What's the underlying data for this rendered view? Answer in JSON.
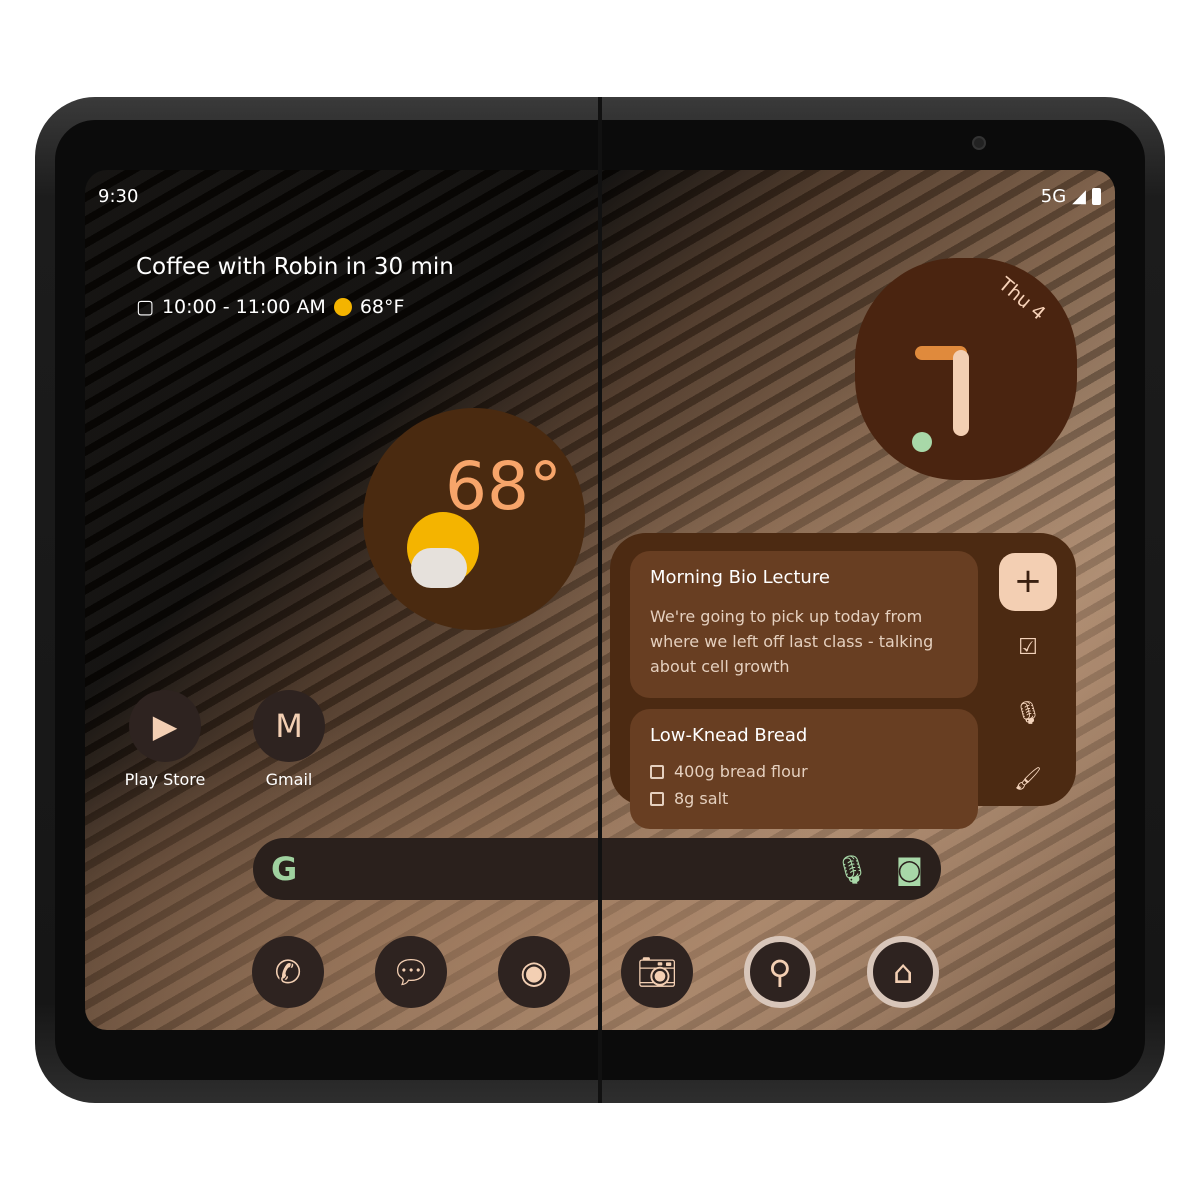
{
  "status": {
    "time": "9:30",
    "network": "5G"
  },
  "glance": {
    "title": "Coffee with Robin in 30 min",
    "time": "10:00 - 11:00 AM",
    "temp": "68°F"
  },
  "weather": {
    "temp": "68°"
  },
  "clock": {
    "date": "Thu 4"
  },
  "notes": [
    {
      "title": "Morning Bio Lecture",
      "body": "We're going to pick up today from where we left off last class - talking about cell growth"
    },
    {
      "title": "Low-Knead Bread",
      "items": [
        "400g bread flour",
        "8g salt"
      ]
    }
  ],
  "apps": [
    {
      "label": "Play Store"
    },
    {
      "label": "Gmail"
    }
  ],
  "search": {
    "logo": "G"
  },
  "dock": [
    "phone-icon",
    "messages-icon",
    "chrome-icon",
    "camera-icon",
    "maps-icon",
    "home-icon"
  ]
}
